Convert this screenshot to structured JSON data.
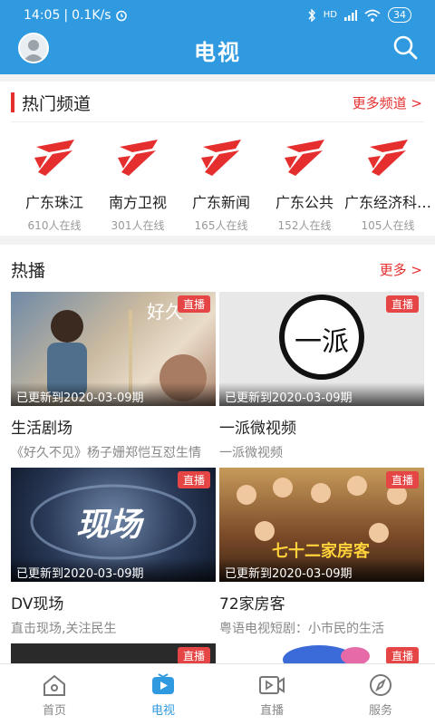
{
  "status": {
    "time": "14:05",
    "speed": "0.1K/s",
    "battery": "34",
    "signal_label": "HD"
  },
  "header": {
    "title": "电视",
    "avatar_icon": "user-avatar",
    "search_icon": "search-icon"
  },
  "hot_channels": {
    "title": "热门频道",
    "more": "更多频道 >",
    "items": [
      {
        "name": "广东珠江",
        "online": "610人在线",
        "icon": "gdtv-logo"
      },
      {
        "name": "南方卫视",
        "online": "301人在线",
        "icon": "gdtv-logo"
      },
      {
        "name": "广东新闻",
        "online": "165人在线",
        "icon": "gdtv-logo"
      },
      {
        "name": "广东公共",
        "online": "152人在线",
        "icon": "gdtv-logo"
      },
      {
        "name": "广东经济科…",
        "online": "105人在线",
        "icon": "gdtv-logo"
      }
    ]
  },
  "hot_play": {
    "title": "热播",
    "more": "更多 >",
    "live_label": "直播",
    "items": [
      {
        "title": "生活剧场",
        "desc": "《好久不见》杨子姗郑恺互怼生情",
        "updated": "已更新到2020-03-09期",
        "thumb_text": "好久"
      },
      {
        "title": "一派微视频",
        "desc": "一派微视频",
        "updated": "已更新到2020-03-09期",
        "thumb_text": "一派"
      },
      {
        "title": "DV现场",
        "desc": "直击现场,关注民生",
        "updated": "已更新到2020-03-09期",
        "thumb_text": "现场"
      },
      {
        "title": "72家房客",
        "desc": "粤语电视短剧：小市民的生活",
        "updated": "已更新到2020-03-09期",
        "thumb_text": "七十二家房客"
      }
    ]
  },
  "tabs": [
    {
      "label": "首页",
      "icon": "home-icon",
      "active": false
    },
    {
      "label": "电视",
      "icon": "tv-icon",
      "active": true
    },
    {
      "label": "直播",
      "icon": "live-video-icon",
      "active": false
    },
    {
      "label": "服务",
      "icon": "compass-icon",
      "active": false
    }
  ],
  "colors": {
    "brand_blue": "#2f9ae0",
    "accent_red": "#e52e2e"
  }
}
